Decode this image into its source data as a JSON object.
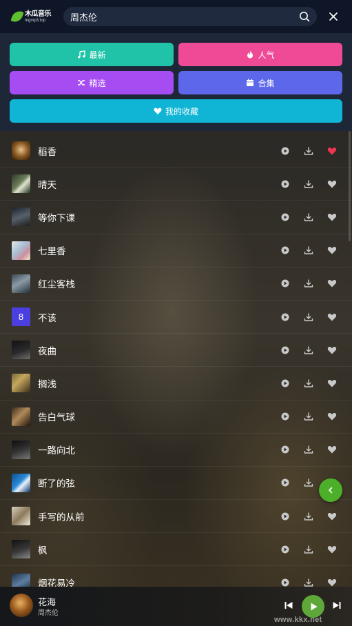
{
  "app": {
    "logo_name": "木瓜音乐",
    "logo_url": "mgmp3.top"
  },
  "search": {
    "value": "周杰伦",
    "placeholder": ""
  },
  "categories": {
    "latest": "最新",
    "popular": "人气",
    "picks": "精选",
    "collection": "合集",
    "favorites": "我的收藏"
  },
  "colors": {
    "latest": "#20c3a7",
    "popular": "#ee4a96",
    "picks": "#a64cf3",
    "collection": "#5d67ea",
    "favorites": "#10b4d4",
    "fav_active": "#f0364f",
    "accent_green": "#4caf2a"
  },
  "songs": [
    {
      "title": "稻香",
      "cover": "rice",
      "favorited": true
    },
    {
      "title": "晴天",
      "cover": "sunny",
      "favorited": false
    },
    {
      "title": "等你下课",
      "cover": "class",
      "favorited": false
    },
    {
      "title": "七里香",
      "cover": "qilixiang",
      "favorited": false
    },
    {
      "title": "红尘客栈",
      "cover": "inn",
      "favorited": false
    },
    {
      "title": "不该",
      "cover": "8",
      "favorited": false
    },
    {
      "title": "夜曲",
      "cover": "nocturne",
      "favorited": false
    },
    {
      "title": "搁浅",
      "cover": "stranded",
      "favorited": false
    },
    {
      "title": "告白气球",
      "cover": "balloon",
      "favorited": false
    },
    {
      "title": "一路向北",
      "cover": "north",
      "favorited": false
    },
    {
      "title": "断了的弦",
      "cover": "jay",
      "favorited": false
    },
    {
      "title": "手写的从前",
      "cover": "handwritten",
      "favorited": false
    },
    {
      "title": "枫",
      "cover": "maple",
      "favorited": false
    },
    {
      "title": "烟花易冷",
      "cover": "fireworks",
      "favorited": false
    }
  ],
  "player": {
    "title": "花海",
    "artist": "周杰伦"
  },
  "watermark": "www.kkx.net",
  "icons": {
    "search": "search-icon",
    "close": "close-icon",
    "play": "play-circle-icon",
    "download": "download-icon",
    "favorite": "heart-icon",
    "back": "chevron-left-icon",
    "prev": "skip-previous-icon",
    "next": "skip-next-icon"
  }
}
